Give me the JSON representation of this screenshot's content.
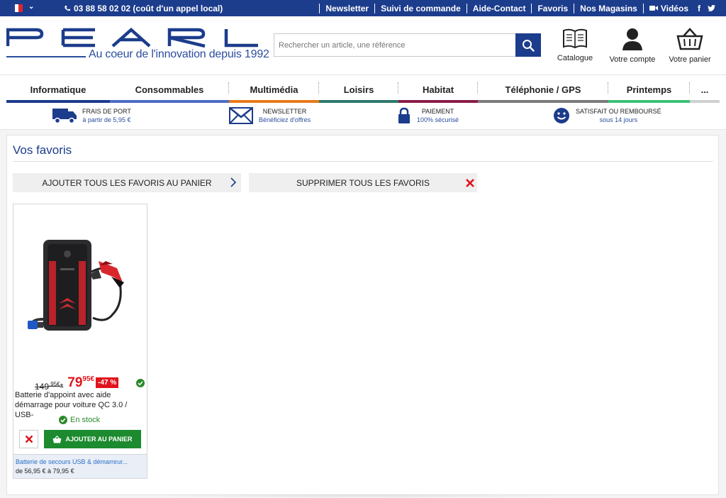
{
  "topbar": {
    "phone": "03 88 58 02 02 (coût d'un appel local)",
    "links": [
      "Newsletter",
      "Suivi de commande",
      "Aide-Contact",
      "Favoris",
      "Nos Magasins"
    ],
    "videos": "Vidéos",
    "flag_colors": [
      "#1f3f95",
      "#ffffff",
      "#e1262d"
    ]
  },
  "header": {
    "logo_tagline": "Au coeur de l'innovation depuis 1992",
    "search_placeholder": "Rechercher un article, une référence",
    "catalogue": "Catalogue",
    "account": "Votre compte",
    "cart": "Votre panier"
  },
  "categories": [
    {
      "label": "Informatique",
      "color": "#1c3c8c"
    },
    {
      "label": "Consommables",
      "color": "#4c6cc7"
    },
    {
      "label": "Multimédia",
      "color": "#e8791a"
    },
    {
      "label": "Loisirs",
      "color": "#2e7a6b"
    },
    {
      "label": "Habitat",
      "color": "#8a1d4a"
    },
    {
      "label": "Téléphonie / GPS",
      "color": "#7b7b7b"
    },
    {
      "label": "Printemps",
      "color": "#3cc27a"
    },
    {
      "label": "...",
      "color": "#cfcfcf"
    }
  ],
  "perks": [
    {
      "line1": "FRAIS DE PORT",
      "line2": "à partir de 5,95 €"
    },
    {
      "line1": "NEWSLETTER",
      "line2": "Bénéficiez d'offres"
    },
    {
      "line1": "PAIEMENT",
      "line2": "100% sécurisé"
    },
    {
      "line1": "SATISFAIT OU REMBOURSÉ",
      "line2": "sous 14 jours"
    }
  ],
  "page": {
    "title": "Vos favoris",
    "add_all": "AJOUTER TOUS LES FAVORIS AU PANIER",
    "delete_all": "SUPPRIMER TOUS LES FAVORIS"
  },
  "product": {
    "old_price_int": "149",
    "old_price_dec": ",95€",
    "old_price_star": "*",
    "new_price_int": "79",
    "new_price_dec": "95€",
    "discount": "-47 %",
    "name": "Batterie d'appoint avec aide démarrage pour voiture QC 3.0 / USB-",
    "stock": "En stock",
    "add_to_cart": "AJOUTER AU PANIER",
    "family_link": "Batterie de secours USB & démarreur...",
    "price_range": "de 56,95 € à 79,95 €"
  },
  "colors": {
    "brand_blue": "#1c3c8c",
    "price_red": "#e0141c",
    "cart_green": "#1c8a2e"
  }
}
